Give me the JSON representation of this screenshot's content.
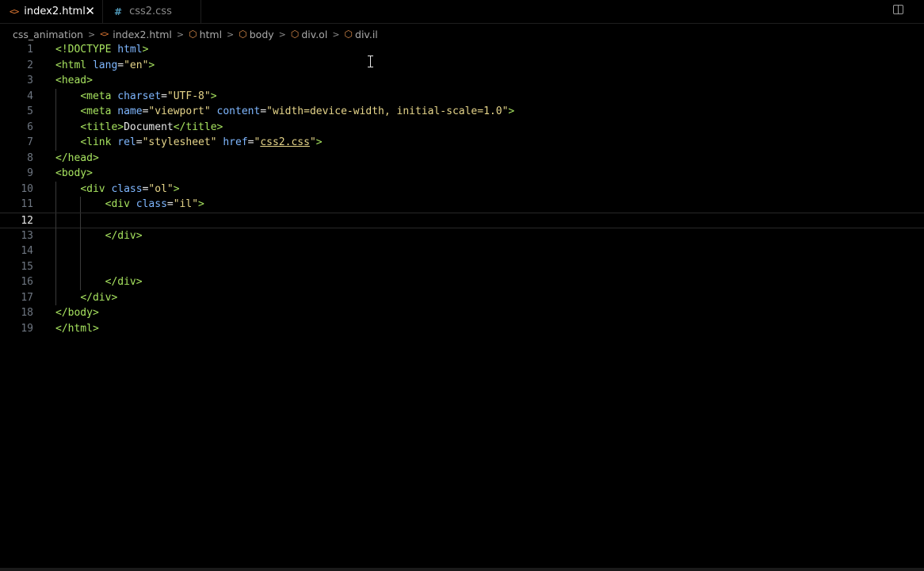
{
  "tabs": [
    {
      "label": "index2.html",
      "icon": "html-file-icon",
      "active": true
    },
    {
      "label": "css2.css",
      "icon": "css-file-icon",
      "active": false
    }
  ],
  "tab_icons": {
    "html": "<>",
    "css": "#",
    "close": "✕"
  },
  "breadcrumb": {
    "folder": "css_animation",
    "file": "index2.html",
    "symbols": [
      "html",
      "body",
      "div.ol",
      "div.il"
    ],
    "separator": ">"
  },
  "editor": {
    "current_line": 12,
    "line_numbers": [
      "1",
      "2",
      "3",
      "4",
      "5",
      "6",
      "7",
      "8",
      "9",
      "10",
      "11",
      "12",
      "13",
      "14",
      "15",
      "16",
      "17",
      "18",
      "19"
    ],
    "lines": [
      "<!DOCTYPE html>",
      "<html lang=\"en\">",
      "<head>",
      "    <meta charset=\"UTF-8\">",
      "    <meta name=\"viewport\" content=\"width=device-width, initial-scale=1.0\">",
      "    <title>Document</title>",
      "    <link rel=\"stylesheet\" href=\"css2.css\">",
      "</head>",
      "<body>",
      "    <div class=\"ol\">",
      "        <div class=\"il\">",
      "",
      "        </div>",
      "",
      "",
      "        </div>",
      "    </div>",
      "</body>",
      "</html>"
    ]
  },
  "colors": {
    "background": "#000000",
    "tag": "#a7e35f",
    "attribute": "#7fb7ff",
    "string": "#e6d58a",
    "html_icon": "#e37933",
    "css_icon": "#519aba"
  }
}
